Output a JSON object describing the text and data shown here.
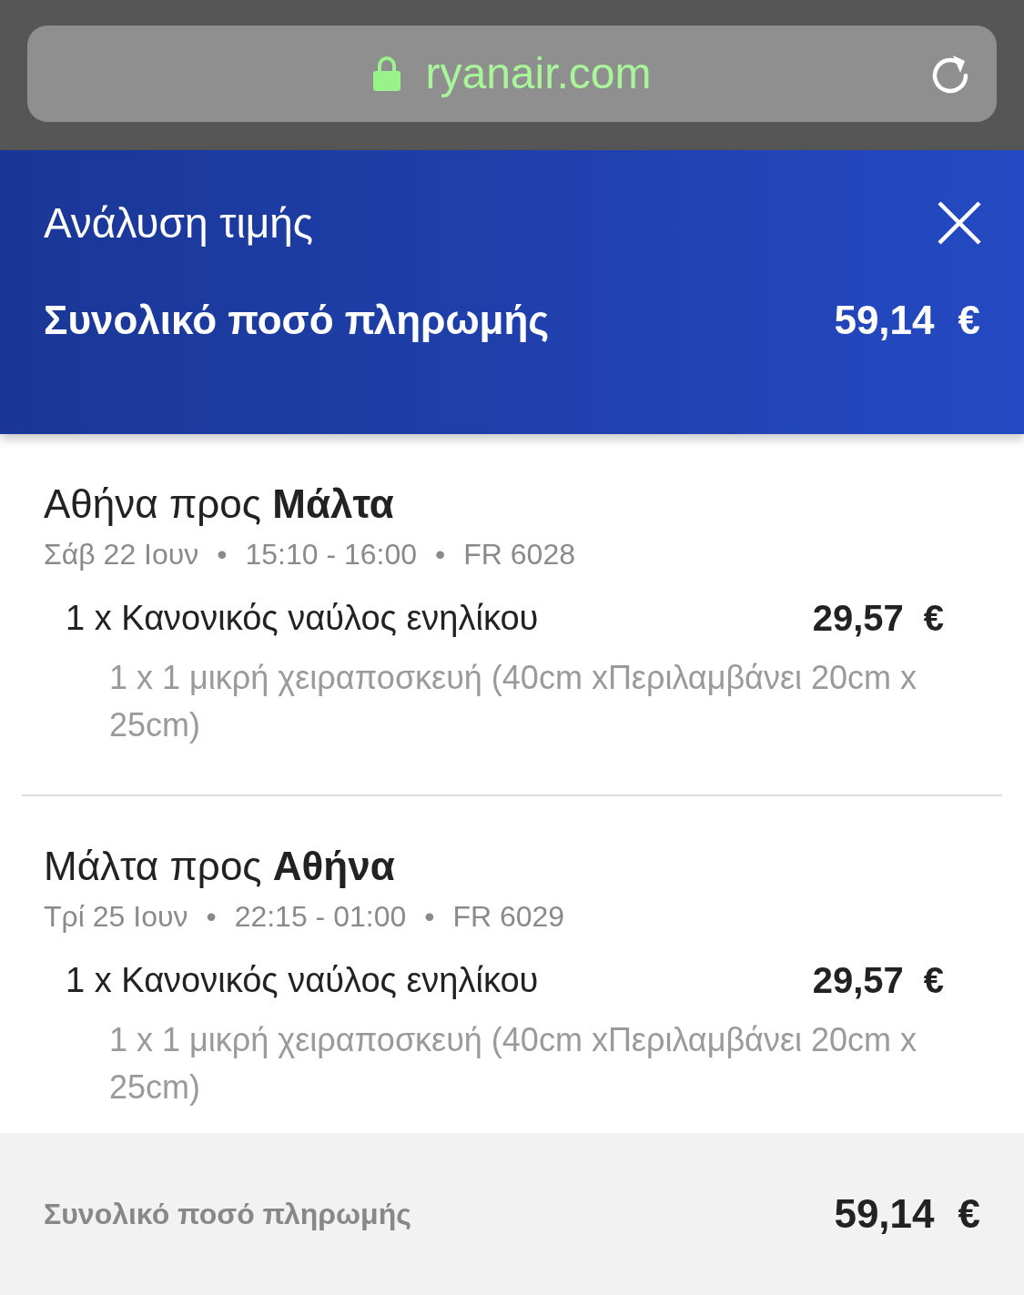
{
  "browser": {
    "url": "ryanair.com"
  },
  "header": {
    "title": "Ανάλυση τιμής",
    "total_label": "Συνολικό ποσό πληρωμής",
    "total_amount": "59,14",
    "total_currency": "€"
  },
  "flights": [
    {
      "route": "Αθήνα προς **Μάλτα**",
      "meta": [
        "Σάβ 22 Ιουν",
        "15:10 - 16:00",
        "FR 6028"
      ],
      "separator": "•",
      "fare": "1 x Κανονικός ναύλος ενηλίκου",
      "amount": "29,57",
      "currency": "€",
      "extra": "1 x 1 μικρή χειραποσκευή (40cm xΠεριλαμβάνει 20cm x 25cm)"
    },
    {
      "route": "Μάλτα προς **Αθήνα**",
      "meta": [
        "Τρί 25 Ιουν",
        "22:15 - 01:00",
        "FR 6029"
      ],
      "separator": "•",
      "fare": "1 x Κανονικός ναύλος ενηλίκου",
      "amount": "29,57",
      "currency": "€",
      "extra": "1 x 1 μικρή χειραποσκευή (40cm xΠεριλαμβάνει 20cm x 25cm)"
    }
  ],
  "footer": {
    "label": "Συνολικό ποσό πληρωμής",
    "amount": "59,14",
    "currency": "€"
  }
}
